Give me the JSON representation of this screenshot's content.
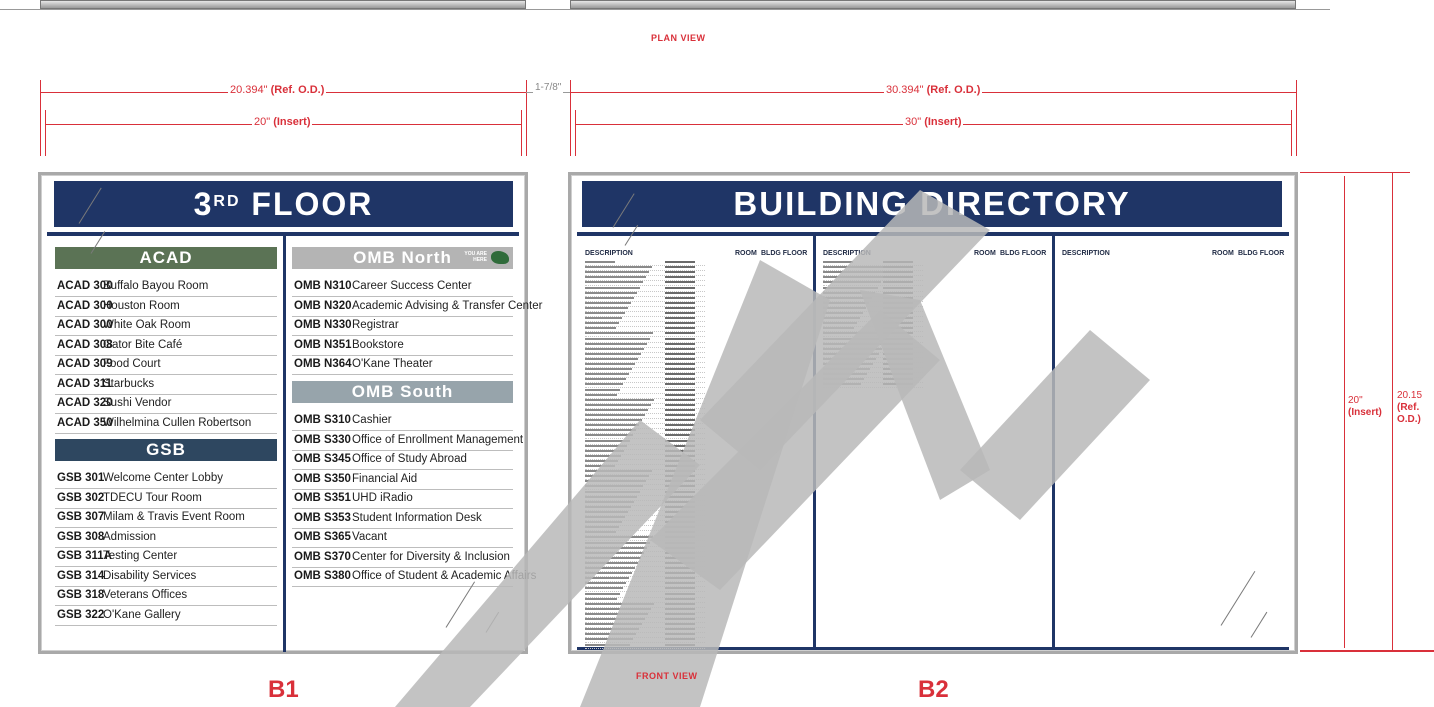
{
  "plan_view_label": "PLAN VIEW",
  "front_view_label": "FRONT VIEW",
  "dimensions": {
    "b1_od": "20.394\"",
    "b1_od_suffix": "(Ref. O.D.)",
    "b1_insert": "20\"",
    "b1_insert_suffix": "(Insert)",
    "gap": "1-7/8\"",
    "b2_od": "30.394\"",
    "b2_od_suffix": "(Ref. O.D.)",
    "b2_insert": "30\"",
    "b2_insert_suffix": "(Insert)",
    "height_insert": "20\"",
    "height_insert_suffix": "(Insert)",
    "height_od": "20.15",
    "height_od_suffix": "(Ref. O.D.)"
  },
  "b1": {
    "label": "B1",
    "title_main": "3",
    "title_sup": "RD",
    "title_rest": " FLOOR",
    "sections": {
      "acad": {
        "title": "ACAD",
        "color": "#5b7355",
        "rows": [
          {
            "code": "ACAD 300",
            "room": "Buffalo Bayou Room"
          },
          {
            "code": "ACAD 300",
            "room": "Houston Room"
          },
          {
            "code": "ACAD 300",
            "room": "White Oak Room"
          },
          {
            "code": "ACAD 308",
            "room": "Gator Bite Café"
          },
          {
            "code": "ACAD 309",
            "room": "Food Court"
          },
          {
            "code": "ACAD 311",
            "room": "Starbucks"
          },
          {
            "code": "ACAD 320",
            "room": "Sushi Vendor"
          },
          {
            "code": "ACAD 350",
            "room": "Wilhelmina Cullen Robertson"
          }
        ]
      },
      "gsb": {
        "title": "GSB",
        "color": "#2e4760",
        "rows": [
          {
            "code": "GSB 301",
            "room": "Welcome Center Lobby"
          },
          {
            "code": "GSB 302",
            "room": "TDECU Tour Room"
          },
          {
            "code": "GSB 307",
            "room": "Milam & Travis Event Room"
          },
          {
            "code": "GSB 308",
            "room": "Admission"
          },
          {
            "code": "GSB 311A",
            "room": "Testing Center"
          },
          {
            "code": "GSB 314",
            "room": "Disability Services"
          },
          {
            "code": "GSB 318",
            "room": "Veterans Offices"
          },
          {
            "code": "GSB 322",
            "room": "O'Kane Gallery"
          }
        ]
      },
      "omb_north": {
        "title": "OMB North",
        "color": "#b4b4b4",
        "you_are_here": "YOU ARE HERE",
        "rows": [
          {
            "code": "OMB N310",
            "room": "Career Success Center"
          },
          {
            "code": "OMB N320",
            "room": "Academic Advising & Transfer Center"
          },
          {
            "code": "OMB N330",
            "room": "Registrar"
          },
          {
            "code": "OMB N351",
            "room": "Bookstore"
          },
          {
            "code": "OMB N364",
            "room": "O'Kane Theater"
          }
        ]
      },
      "omb_south": {
        "title": "OMB South",
        "color": "#97a4ab",
        "rows": [
          {
            "code": "OMB S310",
            "room": "Cashier"
          },
          {
            "code": "OMB S330",
            "room": "Office of Enrollment Management"
          },
          {
            "code": "OMB S345",
            "room": "Office of Study Abroad"
          },
          {
            "code": "OMB S350",
            "room": "Financial Aid"
          },
          {
            "code": "OMB S351",
            "room": "UHD iRadio"
          },
          {
            "code": "OMB S353",
            "room": "Student Information Desk"
          },
          {
            "code": "OMB S365",
            "room": "Vacant"
          },
          {
            "code": "OMB S370",
            "room": "Center for Diversity & Inclusion"
          },
          {
            "code": "OMB S380",
            "room": "Office of Student & Academic Affairs"
          }
        ]
      }
    }
  },
  "b2": {
    "label": "B2",
    "title": "BUILDING DIRECTORY",
    "column_headers": {
      "description": "DESCRIPTION",
      "room": "ROOM",
      "bldg_floor": "BLDG FLOOR"
    }
  },
  "colors": {
    "navy": "#1f3566",
    "dimension_red": "#d9303a",
    "frame_gray": "#a9a9a9"
  }
}
